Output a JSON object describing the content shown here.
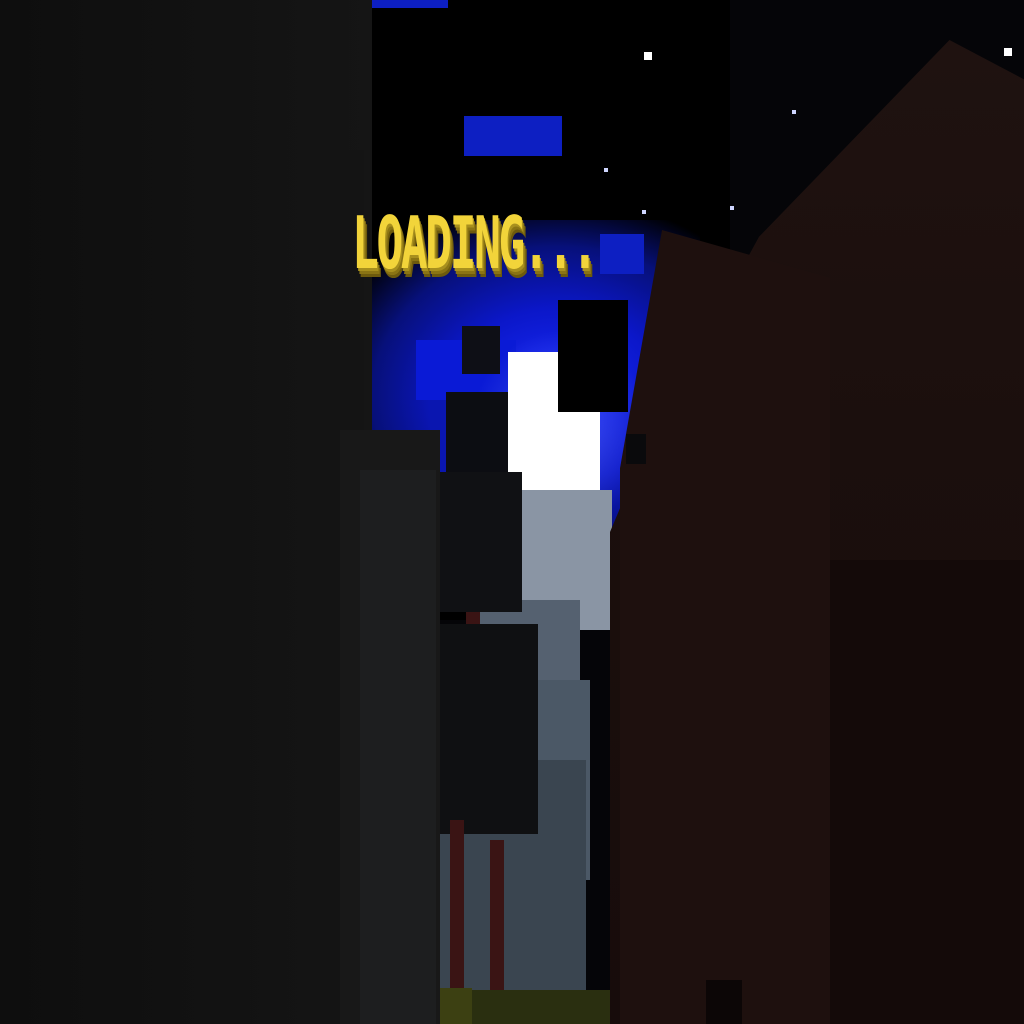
{
  "game": {
    "loading_text": "LOADING..."
  },
  "colors": {
    "loading_text": "#f2d43a",
    "sky": "#000000",
    "sky_glow": "#1a2cff",
    "moon": "#ffffff",
    "left_wall": "#121212",
    "right_wall": "#1e100e"
  }
}
